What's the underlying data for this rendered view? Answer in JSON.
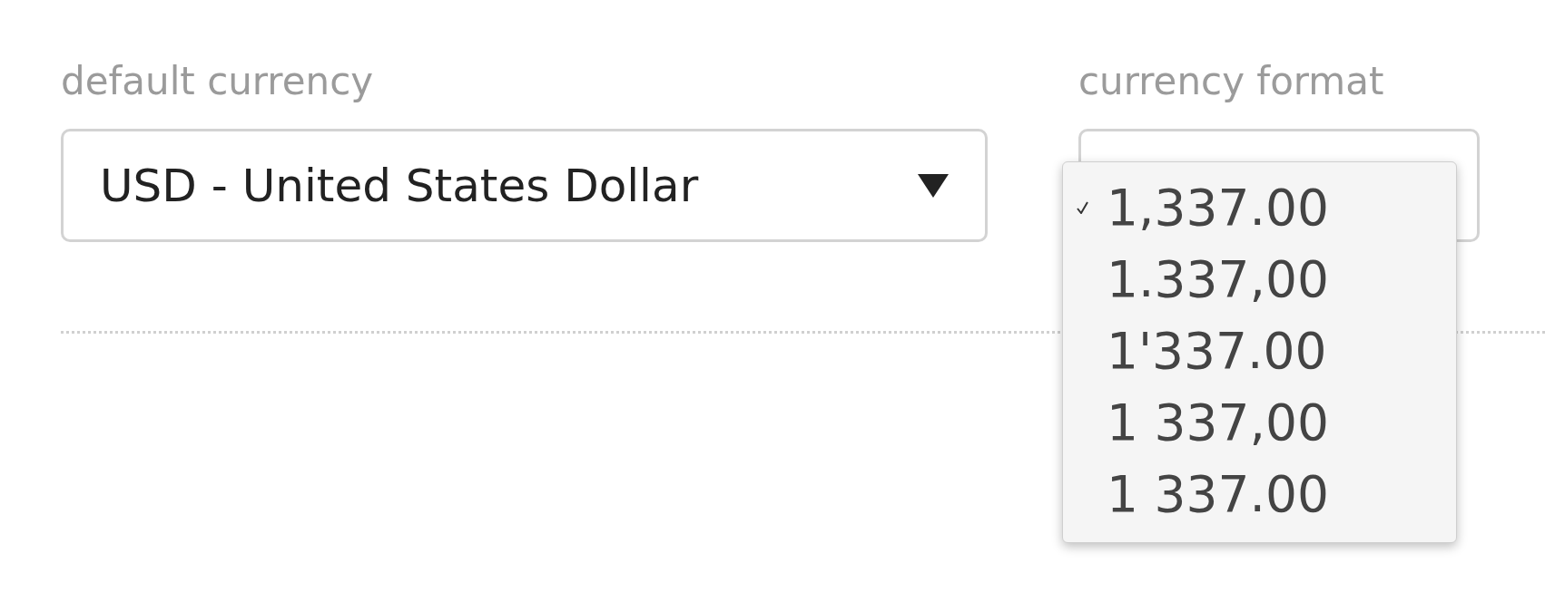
{
  "fields": [
    {
      "label": "default currency",
      "value": "USD - United States Dollar"
    },
    {
      "label": "currency format"
    }
  ],
  "format_menu": {
    "options": [
      {
        "label": "1,337.00",
        "selected": true
      },
      {
        "label": "1.337,00",
        "selected": false
      },
      {
        "label": "1'337.00",
        "selected": false
      },
      {
        "label": "1 337,00",
        "selected": false
      },
      {
        "label": "1 337.00",
        "selected": false
      }
    ]
  }
}
